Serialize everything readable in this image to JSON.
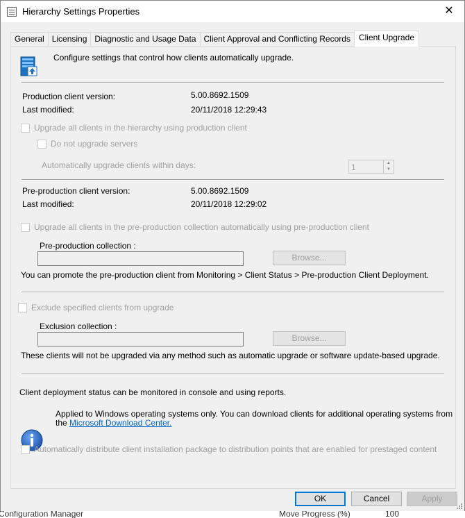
{
  "window": {
    "title": "Hierarchy Settings Properties",
    "close_glyph": "✕"
  },
  "tabs": [
    {
      "label": "General"
    },
    {
      "label": "Licensing"
    },
    {
      "label": "Diagnostic and Usage Data"
    },
    {
      "label": "Client Approval and Conflicting Records"
    },
    {
      "label": "Client Upgrade",
      "active": true
    }
  ],
  "panel": {
    "description": "Configure settings that control how clients automatically upgrade.",
    "production": {
      "version_label": "Production client version:",
      "version_value": "5.00.8692.1509",
      "modified_label": "Last modified:",
      "modified_value": "20/11/2018 12:29:43",
      "upgrade_all_label": "Upgrade all clients in the hierarchy using production client",
      "no_servers_label": "Do not upgrade servers",
      "within_days_label": "Automatically upgrade clients within days:",
      "within_days_value": "1"
    },
    "preproduction": {
      "version_label": "Pre-production client version:",
      "version_value": "5.00.8692.1509",
      "modified_label": "Last modified:",
      "modified_value": "20/11/2018 12:29:02",
      "upgrade_label": "Upgrade all clients in the pre-production collection automatically using pre-production client",
      "collection_label": "Pre-production collection :",
      "collection_value": "",
      "browse_label": "Browse...",
      "promote_note": "You can promote the pre-production client from Monitoring > Client Status > Pre-production Client Deployment."
    },
    "exclusion": {
      "exclude_label": "Exclude specified clients from upgrade",
      "collection_label": "Exclusion collection :",
      "collection_value": "",
      "browse_label": "Browse...",
      "note": "These clients will not be upgraded via any method such as automatic upgrade or software update-based upgrade."
    },
    "status_note": "Client deployment status can be monitored in console and using reports.",
    "info_line1": "Applied to Windows operating systems only. You can download clients for additional operating systems from",
    "info_line2_prefix": "the",
    "info_link": "Microsoft Download Center.",
    "distribute_label": "Automatically distribute client installation package to distribution points that are enabled for prestaged content"
  },
  "buttons": {
    "ok": "OK",
    "cancel": "Cancel",
    "apply": "Apply"
  },
  "background": {
    "left_text": "Configuration Manager",
    "mid_text": "Move Progress (%)",
    "right_text": "100"
  },
  "colors": {
    "accent": "#0078d7",
    "link": "#0066cc",
    "disabled_text": "#a0a0a0"
  }
}
